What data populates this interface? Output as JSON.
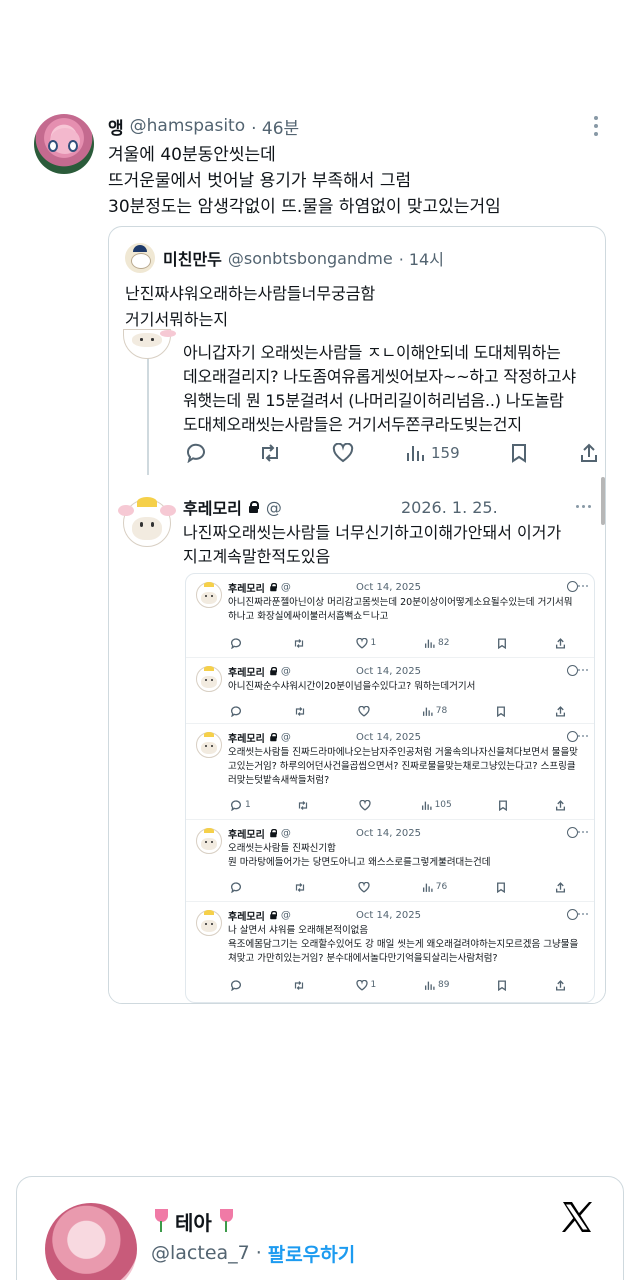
{
  "main_tweet": {
    "display_name": "앵",
    "handle": "@hamspasito",
    "time": "· 46분",
    "text": "겨울에 40분동안씻는데\n뜨거운물에서 벗어날 용기가 부족해서 그럼\n30분정도는 암생각없이 뜨.물을 하염없이 맞고있는거임"
  },
  "quoted_tweet": {
    "display_name": "미친만두",
    "handle": "@sonbtsbongandme",
    "time": "· 14시",
    "text": "난진짜샤워오래하는사람들너무궁금함\n거기서뭐하는지"
  },
  "screenshot": {
    "upper_text": "아니갑자기 오래씻는사람들 ㅈㄴ이해안되네 도대체뭐하는\n데오래걸리지? 나도좀여유롭게씻어보자~~하고 작정하고샤\n워햇는데 뭔 15분걸려서 (나머리길이허리넘음..) 나도놀람\n도대체오래씻는사람들은 거기서두쫀쿠라도빚는건지",
    "upper_likes": "159",
    "reply": {
      "display_name": "후레모리",
      "at": "@",
      "date": "2026. 1. 25.",
      "text": "나진짜오래씻는사람들 너무신기하고이해가안돼서 이거가\n지고계속말한적도있음"
    },
    "mini_tweets": [
      {
        "name": "후레모리",
        "at": "@",
        "date": "Oct 14, 2025",
        "text": "아니진짜라푼젤아닌이상 머리감고몸씻는데 20분이상이어떻게소요될수있는데 거기서뭐\n하나고 화장실에싸이불러서흠뻑쇼ᄃ나고",
        "replies": "",
        "reposts": "",
        "likes": "1",
        "views": "82"
      },
      {
        "name": "후레모리",
        "at": "@",
        "date": "Oct 14, 2025",
        "text": "아니진짜순수샤워시간이20분이넘을수있다고? 뭐하는데거기서",
        "replies": "",
        "reposts": "",
        "likes": "",
        "views": "78"
      },
      {
        "name": "후레모리",
        "at": "@",
        "date": "Oct 14, 2025",
        "text": "오래씻는사람들 진짜드라마에나오는남자주인공처럼 거울속의나자신을쳐다보면서 물을맞\n고있는거임? 하루의어던사건을곱씹으면서? 진짜로물을맞는채로그냥있는다고? 스프링클\n러맞는텃밭속새싹들처럼?",
        "replies": "1",
        "reposts": "",
        "likes": "",
        "views": "105"
      },
      {
        "name": "후레모리",
        "at": "@",
        "date": "Oct 14, 2025",
        "text": "오래씻는사람들 진짜신기함\n뭔 마라탕에들어가는 당면도아니고 왜스스로를그렇게불려대는건데",
        "replies": "",
        "reposts": "",
        "likes": "",
        "views": "76"
      },
      {
        "name": "후레모리",
        "at": "@",
        "date": "Oct 14, 2025",
        "text": "나 살면서 샤워를 오래해본적이없음\n욕조에몸담그기는 오래할수있어도 강 매일 씻는게 왜오래걸려야하는지모르겠음 그냥물을\n쳐맞고 가만히있는거임? 분수대에서놀다만기억을되살리는사람처럼?",
        "replies": "",
        "reposts": "",
        "likes": "1",
        "views": "89"
      }
    ]
  },
  "author_card": {
    "name": "테아",
    "handle": "@lactea_7",
    "separator": "·",
    "follow_label": "팔로우하기"
  },
  "colors": {
    "accent": "#1d9bf0",
    "text": "#0f1419",
    "muted": "#536471",
    "border": "#cfd9de"
  }
}
